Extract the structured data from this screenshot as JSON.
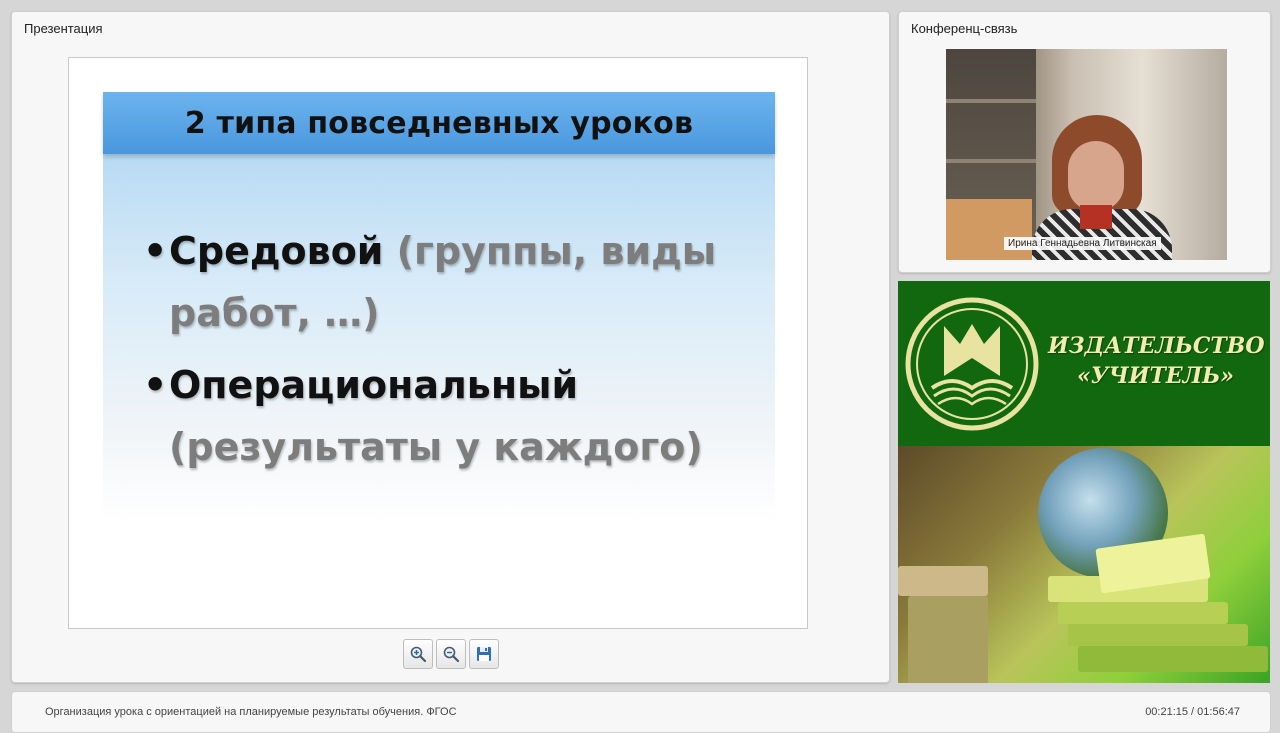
{
  "presentation_panel": {
    "title": "Презентация"
  },
  "slide": {
    "title": "2 типа  повседневных уроков",
    "bullets": [
      {
        "main": "Средовой",
        "detail": "(группы, виды",
        "detail_cont": "работ, …)"
      },
      {
        "main": "Операциональный",
        "detail_cont": "(результаты у каждого)"
      }
    ]
  },
  "toolbar": {
    "zoom_in_icon": "zoom-in-icon",
    "zoom_out_icon": "zoom-out-icon",
    "save_icon": "save-icon"
  },
  "conference_panel": {
    "title": "Конференц-связь",
    "participant_name": "Ирина Геннадьевна Литвинская"
  },
  "ad": {
    "line1": "ИЗДАТЕЛЬСТВО",
    "line2": "«УЧИТЕЛЬ»",
    "bg_color": "#11680f"
  },
  "footer": {
    "lecture_title": "Организация урока с ориентацией на планируемые результаты обучения. ФГОС",
    "time": "00:21:15 / 01:56:47"
  }
}
